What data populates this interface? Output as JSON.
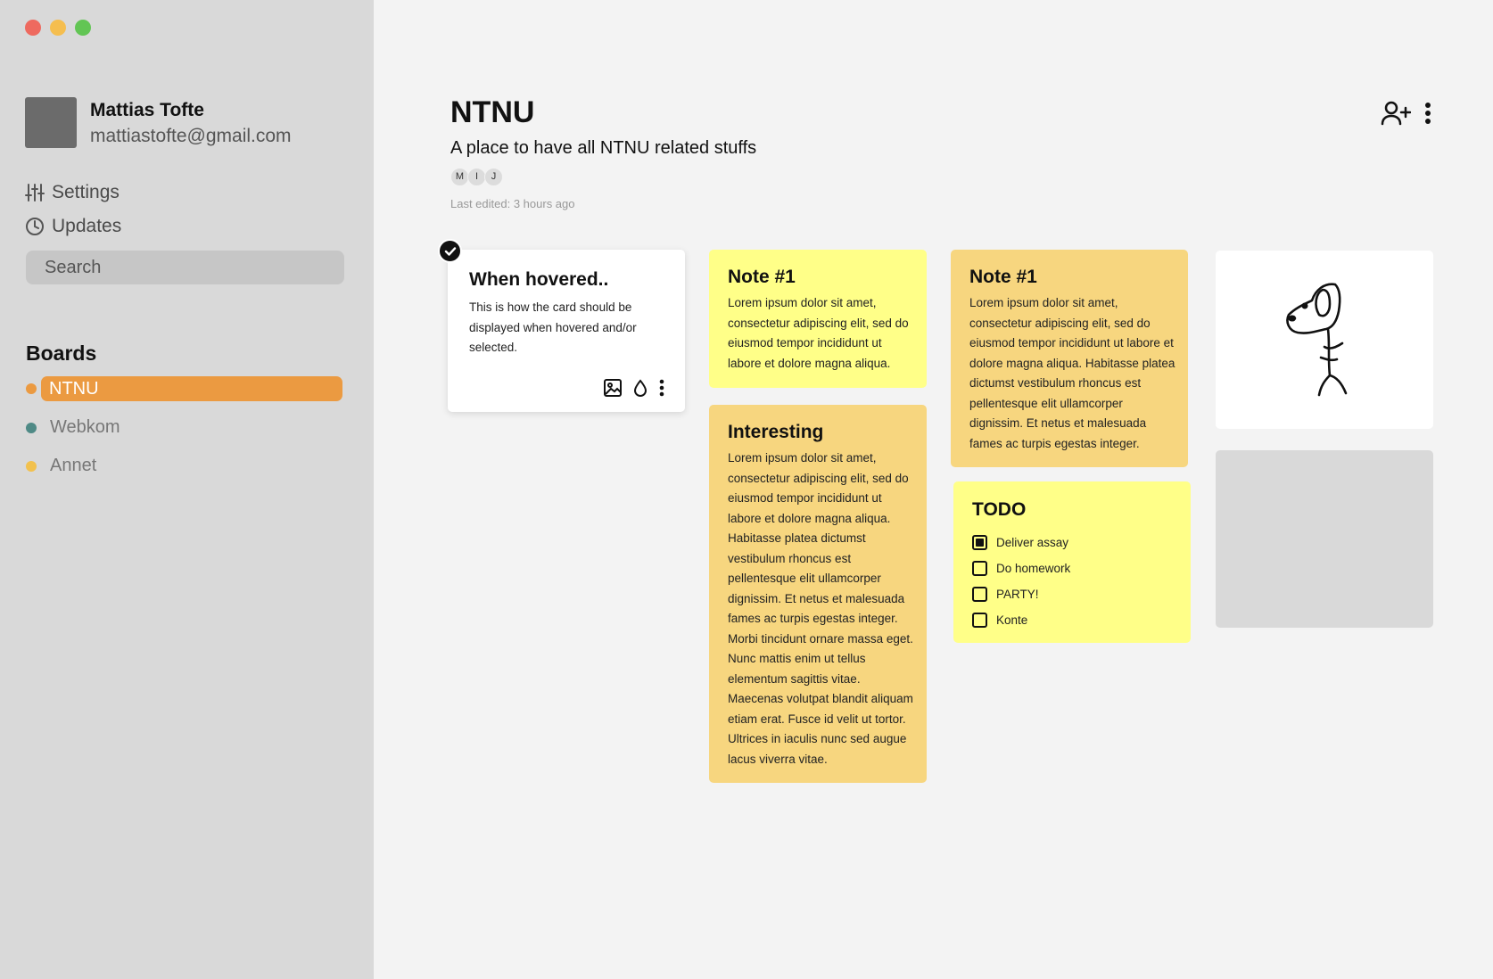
{
  "user": {
    "name": "Mattias Tofte",
    "email": "mattiastofte@gmail.com"
  },
  "nav": {
    "settings": "Settings",
    "updates": "Updates"
  },
  "search": {
    "placeholder": "Search"
  },
  "boards": {
    "heading": "Boards",
    "items": [
      {
        "label": "NTNU",
        "color": "#eb9a41",
        "active": true
      },
      {
        "label": "Webkom",
        "color": "#4f8a86",
        "active": false
      },
      {
        "label": "Annet",
        "color": "#f2c14e",
        "active": false
      }
    ]
  },
  "board": {
    "title": "NTNU",
    "subtitle": "A place to have all NTNU related stuffs",
    "members": [
      "M",
      "I",
      "J"
    ],
    "last_edited": "Last edited: 3 hours ago"
  },
  "cards": {
    "hovered": {
      "title": "When hovered..",
      "body": "This is how the card should be displayed when hovered and/or selected."
    },
    "note1a": {
      "title": "Note #1",
      "body": "Lorem ipsum dolor sit amet, consectetur adipiscing elit, sed do eiusmod tempor incididunt ut labore et dolore magna aliqua."
    },
    "interesting": {
      "title": "Interesting",
      "body": "Lorem ipsum dolor sit amet, consectetur adipiscing elit, sed do eiusmod tempor incididunt ut labore et dolore magna aliqua. Habitasse platea dictumst vestibulum rhoncus est pellentesque elit ullamcorper dignissim. Et netus et malesuada fames ac turpis egestas integer. Morbi tincidunt ornare massa eget. Nunc mattis enim ut tellus elementum sagittis vitae. Maecenas volutpat blandit aliquam etiam erat. Fusce id velit ut tortor. Ultrices in iaculis nunc sed augue lacus viverra vitae."
    },
    "note1b": {
      "title": "Note #1",
      "body": "Lorem ipsum dolor sit amet, consectetur adipiscing elit, sed do eiusmod tempor incididunt ut labore et dolore magna aliqua. Habitasse platea dictumst vestibulum rhoncus est pellentesque elit ullamcorper dignissim. Et netus et malesuada fames ac turpis egestas integer."
    },
    "todo": {
      "title": "TODO",
      "items": [
        {
          "label": "Deliver assay",
          "checked": true
        },
        {
          "label": "Do homework",
          "checked": false
        },
        {
          "label": "PARTY!",
          "checked": false
        },
        {
          "label": "Konte",
          "checked": false
        }
      ]
    }
  },
  "colors": {
    "sidebar": "#d9d9d9",
    "accent": "#eb9a41",
    "note_yellow": "#ffff88",
    "note_orange": "#f7d67f"
  },
  "icons": {
    "settings": "sliders-icon",
    "updates": "clock-icon",
    "add_user": "user-plus-icon",
    "more": "kebab-menu-icon",
    "image": "image-icon",
    "color": "droplet-icon",
    "selected": "check-icon",
    "drawing": "dog-sketch"
  }
}
